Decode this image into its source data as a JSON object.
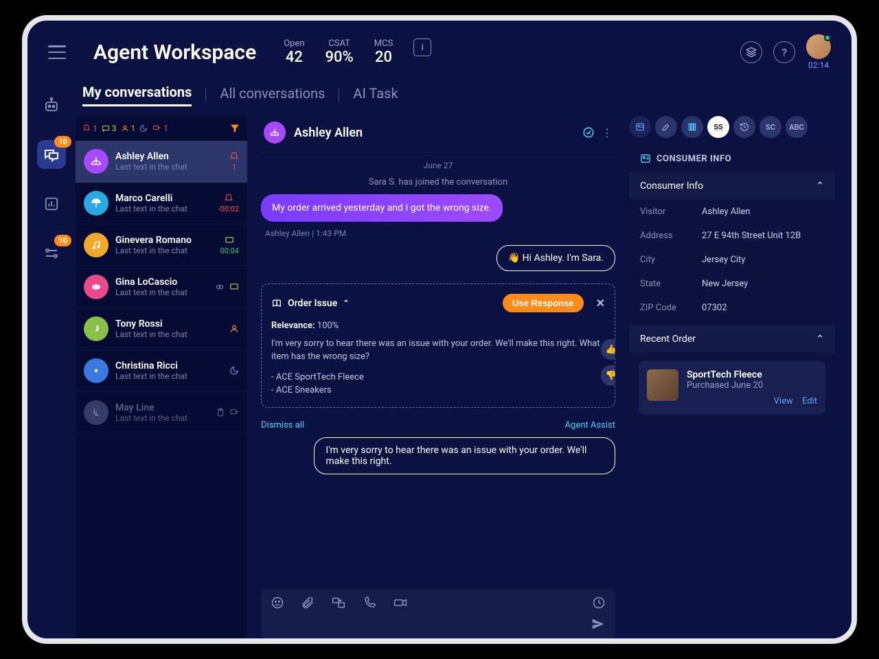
{
  "header": {
    "title": "Agent Workspace",
    "stats": {
      "open_label": "Open",
      "open_val": "42",
      "csat_label": "CSAT",
      "csat_val": "90%",
      "mcs_label": "MCS",
      "mcs_val": "20"
    },
    "timer": "02:14"
  },
  "rail": {
    "chat_badge": "10",
    "flow_badge": "10"
  },
  "tabs": {
    "my": "My conversations",
    "all": "All conversations",
    "ai": "AI Task"
  },
  "filters": {
    "bell": "1",
    "chat": "3",
    "user": "1",
    "moon": "",
    "flag": "1"
  },
  "conversations": [
    {
      "name": "Ashley Allen",
      "sub": "Last text in the chat",
      "color": "#a54aff",
      "badge": "1",
      "bell": true
    },
    {
      "name": "Marco Carelli",
      "sub": "Last text in the chat",
      "color": "#2aa8e0",
      "time": "-00:02",
      "timecolor": "#ff4a4a",
      "bell": true
    },
    {
      "name": "Ginevera Romano",
      "sub": "Last text in the chat",
      "color": "#f2a828",
      "time": "00:04",
      "timecolor": "#2ecc71",
      "sq": true
    },
    {
      "name": "Gina LoCascio",
      "sub": "Last text in the chat",
      "color": "#e84a8a",
      "icons": "rings-sq"
    },
    {
      "name": "Tony Rossi",
      "sub": "Last text in the chat",
      "color": "#88c048",
      "icons": "user"
    },
    {
      "name": "Christina Ricci",
      "sub": "Last text in the chat",
      "color": "#3a7ae0",
      "icons": "moon"
    },
    {
      "name": "May Line",
      "sub": "Last text in the chat",
      "color": "#555d88",
      "inactive": true
    }
  ],
  "chat": {
    "name": "Ashley Allen",
    "date": "June 27",
    "joined": "Sara S. has joined the conversation",
    "msg_user": "My order arrived yesterday and I got the wrong size.",
    "msg_meta": "Ashley Allen  |  1:43 PM",
    "msg_agent": "👋 Hi Ashley. I'm Sara.",
    "suggestion": {
      "title": "Order Issue",
      "use": "Use Response",
      "relevance_label": "Relevance:",
      "relevance_val": "100%",
      "body": "I'm very sorry to hear there was an issue with your order. We'll make this right. What item has the wrong size?",
      "item1": "- ACE SportTech Fleece",
      "item2": "- ACE Sneakers",
      "dismiss": "Dismiss all",
      "assist": "Agent Assist"
    },
    "draft": "I'm very sorry to hear there was an issue with your order. We'll make this right."
  },
  "sidepanel": {
    "chips": [
      "SC",
      "ABC"
    ],
    "consumer_title": "CONSUMER INFO",
    "consumer_sub": "Consumer Info",
    "fields": {
      "visitor_k": "Visitor",
      "visitor_v": "Ashley Allen",
      "address_k": "Address",
      "address_v": "27 E 94th Street Unit 12B",
      "city_k": "City",
      "city_v": "Jersey City",
      "state_k": "State",
      "state_v": "New Jersey",
      "zip_k": "ZIP Code",
      "zip_v": "07302"
    },
    "order_sub": "Recent Order",
    "order": {
      "name": "SportTech Fleece",
      "date": "Purchased June 20",
      "view": "View",
      "edit": "Edit"
    }
  }
}
